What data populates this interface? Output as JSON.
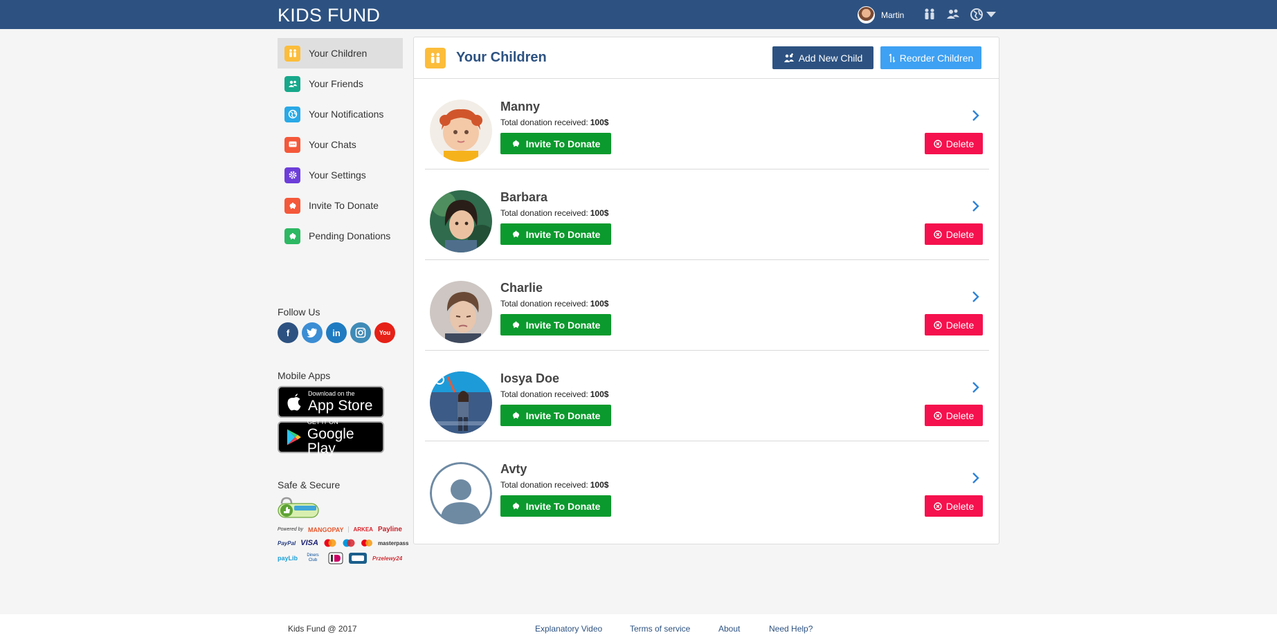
{
  "brand": "KIDS FUND",
  "user": {
    "name": "Martin"
  },
  "top_icons": [
    "children-icon",
    "friends-icon",
    "globe-icon",
    "caret-down-icon"
  ],
  "sidebar": {
    "items": [
      {
        "label": "Your Children",
        "icon": "children-icon",
        "color": "#fcbd3b",
        "active": true
      },
      {
        "label": "Your Friends",
        "icon": "friends-icon",
        "color": "#17a88b"
      },
      {
        "label": "Your Notifications",
        "icon": "globe-icon",
        "color": "#29a9e6"
      },
      {
        "label": "Your Chats",
        "icon": "chat-icon",
        "color": "#f4583a"
      },
      {
        "label": "Your Settings",
        "icon": "gear-icon",
        "color": "#6d3ed9"
      },
      {
        "label": "Invite To Donate",
        "icon": "piggy-bank-icon",
        "color": "#f4583a"
      },
      {
        "label": "Pending Donations",
        "icon": "piggy-bank-icon",
        "color": "#2db863"
      }
    ]
  },
  "follow_us": {
    "title": "Follow Us",
    "networks": [
      {
        "name": "facebook",
        "glyph": "f",
        "color": "#2d5281"
      },
      {
        "name": "twitter",
        "glyph": "t",
        "color": "#3b8dd4"
      },
      {
        "name": "linkedin",
        "glyph": "in",
        "color": "#1f7bc1"
      },
      {
        "name": "instagram",
        "glyph": "◎",
        "color": "#3f8bb7"
      },
      {
        "name": "youtube",
        "glyph": "You",
        "color": "#e62117"
      }
    ]
  },
  "mobile_apps": {
    "title": "Mobile Apps",
    "app_store_small": "Download on the",
    "app_store_big": "App Store",
    "google_small": "GET IT ON",
    "google_big": "Google Play"
  },
  "safe_secure": {
    "title": "Safe & Secure",
    "comodo": "COMODO SECURE",
    "row1": [
      "Powered by",
      "MANGOPAY",
      "ARKEA",
      "Payline"
    ],
    "row2": [
      "PayPal",
      "VISA",
      "masterpass"
    ],
    "row3": [
      "payLib",
      "Diners Club",
      "Przelewy24"
    ]
  },
  "panel": {
    "title": "Your Children",
    "add_button": "Add New Child",
    "reorder_button": "Reorder Children"
  },
  "children": [
    {
      "name": "Manny",
      "total_label": "Total donation received:",
      "total": "100$",
      "invite": "Invite To Donate",
      "delete": "Delete",
      "photo": "girl-red-hair"
    },
    {
      "name": "Barbara",
      "total_label": "Total donation received:",
      "total": "100$",
      "invite": "Invite To Donate",
      "delete": "Delete",
      "photo": "child-green"
    },
    {
      "name": "Charlie",
      "total_label": "Total donation received:",
      "total": "100$",
      "invite": "Invite To Donate",
      "delete": "Delete",
      "photo": "boy-sad"
    },
    {
      "name": "Iosya Doe",
      "total_label": "Total donation received:",
      "total": "100$",
      "invite": "Invite To Donate",
      "delete": "Delete",
      "photo": "woman-blue"
    },
    {
      "name": "Avty",
      "total_label": "Total donation received:",
      "total": "100$",
      "invite": "Invite To Donate",
      "delete": "Delete",
      "photo": "default-avatar"
    }
  ],
  "footer": {
    "copyright": "Kids Fund @ 2017",
    "links": [
      "Explanatory Video",
      "Terms of service",
      "About",
      "Need Help?"
    ]
  },
  "colors": {
    "header": "#2d5281",
    "invite": "#0b9a2d",
    "delete": "#f5114d",
    "reorder": "#3ea1f3",
    "accent": "#fcbd3b"
  }
}
